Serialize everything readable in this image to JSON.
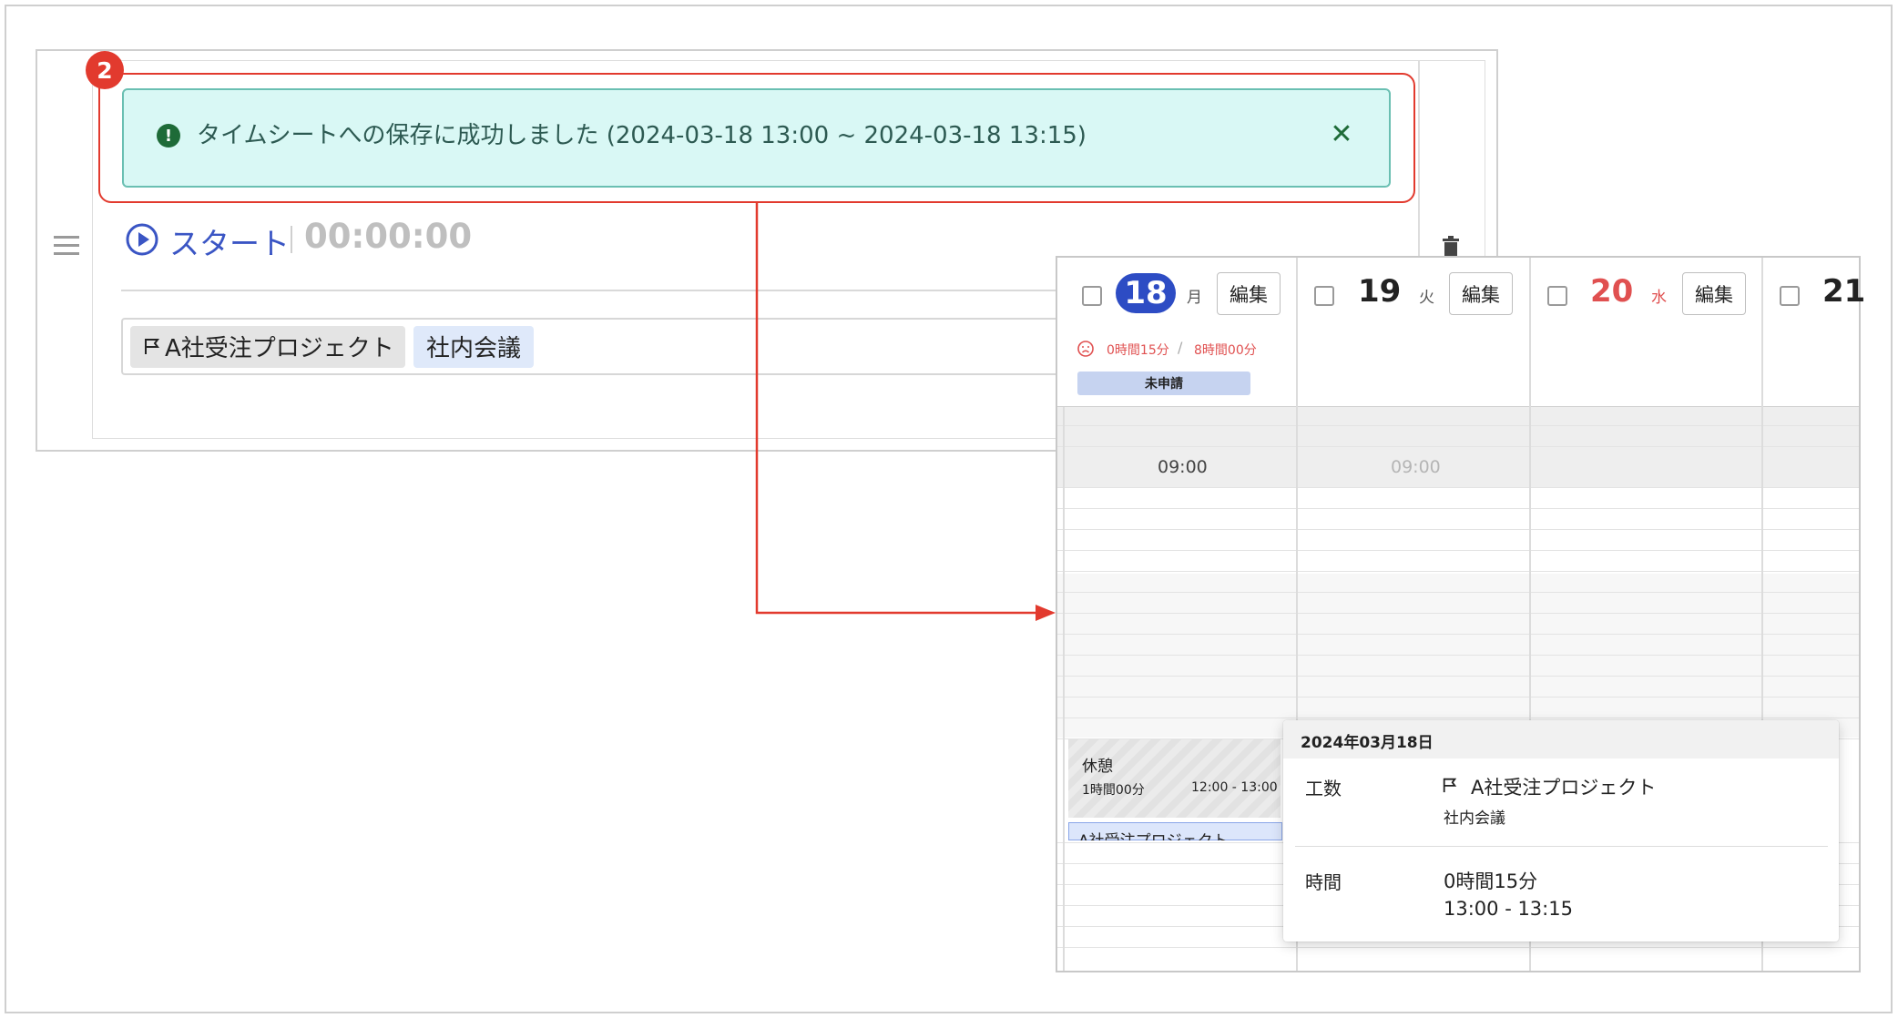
{
  "badge": {
    "number": "2"
  },
  "toast": {
    "message": "タイムシートへの保存に成功しました (2024-03-18 13:00 ~ 2024-03-18 13:15)",
    "icon": "alert-circle-icon",
    "close_icon": "close-icon",
    "close_glyph": "✕"
  },
  "timer": {
    "start_label": "スタート",
    "separator": "|",
    "elapsed": "00:00:00"
  },
  "tags": [
    {
      "label": "A社受注プロジェクト",
      "icon": "flag-icon"
    },
    {
      "label": "社内会議"
    }
  ],
  "calendar": {
    "days": [
      {
        "number": "18",
        "weekday": "月",
        "edit_label": "編集",
        "selected": true
      },
      {
        "number": "19",
        "weekday": "火",
        "edit_label": "編集"
      },
      {
        "number": "20",
        "weekday": "水",
        "edit_label": "編集",
        "holiday": true
      },
      {
        "number": "21"
      }
    ],
    "day18_status": {
      "recorded": "0時間15分",
      "separator": "/",
      "required": "8時間00分",
      "application_badge": "未申請"
    },
    "time_labels": [
      "09:00",
      "09:00"
    ],
    "break_block": {
      "title": "休憩",
      "duration": "1時間00分",
      "range": "12:00 - 13:00"
    },
    "entry_block": {
      "title": "A社受注プロジェクト"
    }
  },
  "popup": {
    "date": "2024年03月18日",
    "work_label": "工数",
    "project": "A社受注プロジェクト",
    "task": "社内会議",
    "time_label": "時間",
    "duration": "0時間15分",
    "range": "13:00 - 13:15"
  },
  "colors": {
    "highlight": "#e23a2e",
    "accent_blue": "#2d4cc4",
    "toast_bg": "#d9f8f5",
    "success_green": "#1e6b38",
    "warning_red": "#e05050"
  }
}
